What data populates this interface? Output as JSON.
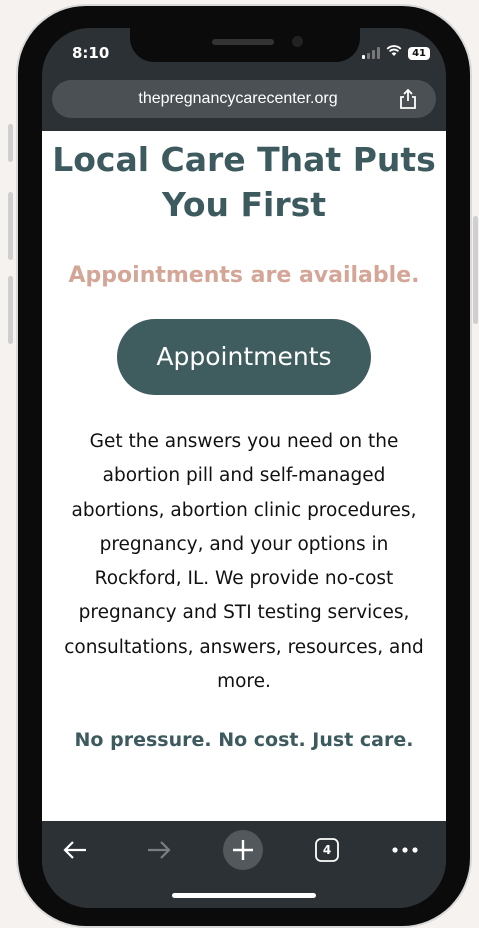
{
  "status_bar": {
    "time": "8:10",
    "battery": "41"
  },
  "browser": {
    "url": "thepregnancycarecenter.org",
    "tab_count": "4"
  },
  "page": {
    "title": "Local Care That Puts You First",
    "subtitle": "Appointments are available.",
    "cta_label": "Appointments",
    "body": "Get the answers you need on the abortion pill and self-managed abortions, abortion clinic procedures, pregnancy, and your options in Rockford, IL. We provide no-cost pregnancy and STI testing services, consultations, answers, resources, and more.",
    "tagline": "No pressure. No cost. Just care."
  },
  "colors": {
    "heading": "#3d5a5e",
    "accent": "#d4a697",
    "button": "#3f5c5f"
  },
  "icons": [
    "share-icon",
    "back-icon",
    "forward-icon",
    "new-tab-icon",
    "tabs-icon",
    "more-icon"
  ]
}
